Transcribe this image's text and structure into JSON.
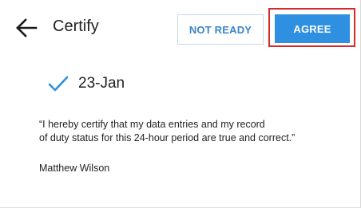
{
  "header": {
    "title": "Certify",
    "back_icon": "arrow-left-icon",
    "not_ready_label": "NOT READY",
    "agree_label": "AGREE"
  },
  "certification": {
    "date": "23-Jan",
    "check_icon": "checkmark-icon",
    "statement_line1": "“I hereby certify that my data entries and my record",
    "statement_line2": "of duty status for this 24-hour period are true and correct.”",
    "signer_name": "Matthew Wilson"
  },
  "colors": {
    "accent": "#2f8fe0",
    "secondary_text": "#3a86c7",
    "highlight_outline": "#d62b2b"
  }
}
